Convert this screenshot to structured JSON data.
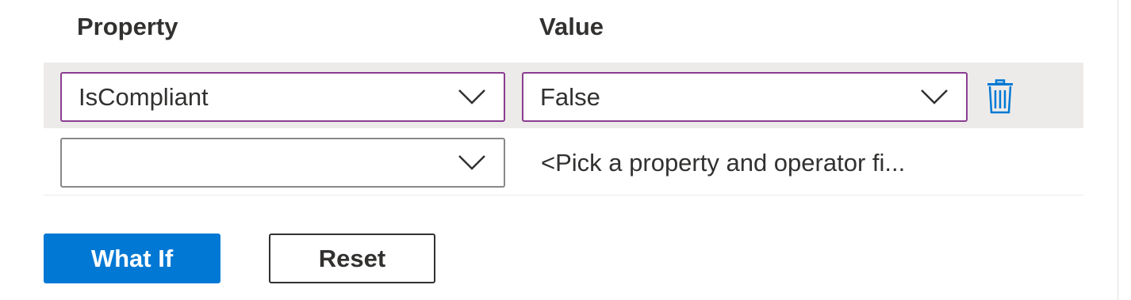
{
  "headers": {
    "property": "Property",
    "value": "Value"
  },
  "rows": [
    {
      "property": "IsCompliant",
      "value": "False",
      "delete_icon": "trash-icon"
    },
    {
      "property": "",
      "value_placeholder": "<Pick a property and operator fi..."
    }
  ],
  "buttons": {
    "what_if": "What If",
    "reset": "Reset"
  },
  "colors": {
    "accent_primary": "#0078d4",
    "focus_border": "#8a3d91",
    "selected_row_bg": "#edebe9",
    "text": "#323130",
    "input_border": "#8a8886"
  }
}
